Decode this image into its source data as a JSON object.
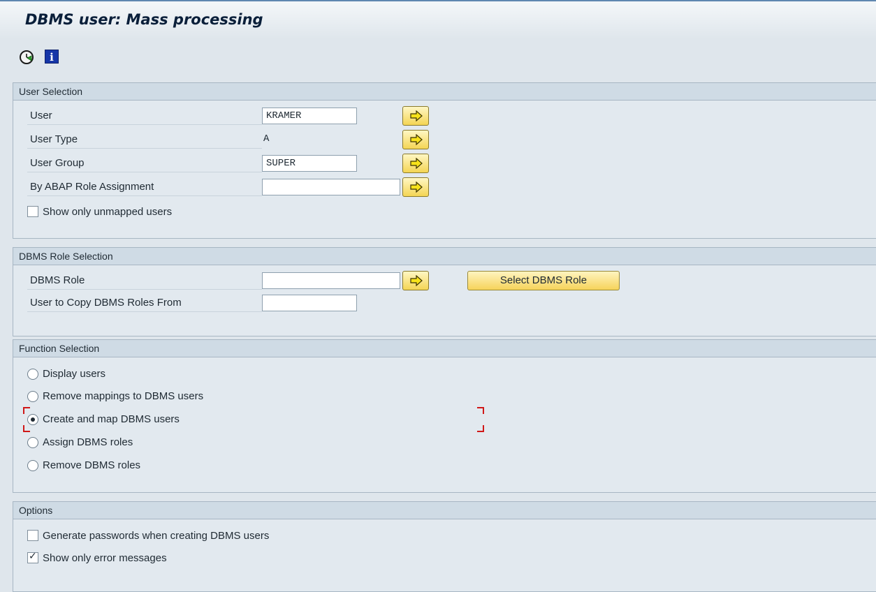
{
  "window": {
    "title": "DBMS user: Mass processing"
  },
  "toolbar": {
    "execute_icon": "execute-icon",
    "info_icon": "info-icon",
    "info_glyph": "i"
  },
  "user_selection": {
    "header": "User Selection",
    "user_label": "User",
    "user_value": "KRAMER",
    "user_type_label": "User Type",
    "user_type_value": "A",
    "user_group_label": "User Group",
    "user_group_value": "SUPER",
    "abap_role_label": "By ABAP Role Assignment",
    "abap_role_value": "",
    "unmapped_label": "Show only unmapped users",
    "unmapped_checked": false
  },
  "dbms_role_selection": {
    "header": "DBMS Role Selection",
    "dbms_role_label": "DBMS Role",
    "dbms_role_value": "",
    "select_button": "Select DBMS Role",
    "copy_from_label": "User to Copy DBMS Roles From",
    "copy_from_value": ""
  },
  "function_selection": {
    "header": "Function Selection",
    "options": [
      {
        "label": "Display users",
        "selected": false
      },
      {
        "label": "Remove mappings to DBMS users",
        "selected": false
      },
      {
        "label": "Create and map DBMS users",
        "selected": true
      },
      {
        "label": "Assign DBMS roles",
        "selected": false
      },
      {
        "label": "Remove DBMS roles",
        "selected": false
      }
    ]
  },
  "options": {
    "header": "Options",
    "generate_passwords_label": "Generate passwords when creating DBMS users",
    "generate_passwords_checked": false,
    "errors_only_label": "Show only error messages",
    "errors_only_checked": true
  },
  "colors": {
    "accent_button": "#f6d35a",
    "selection_marker": "#d01818"
  }
}
